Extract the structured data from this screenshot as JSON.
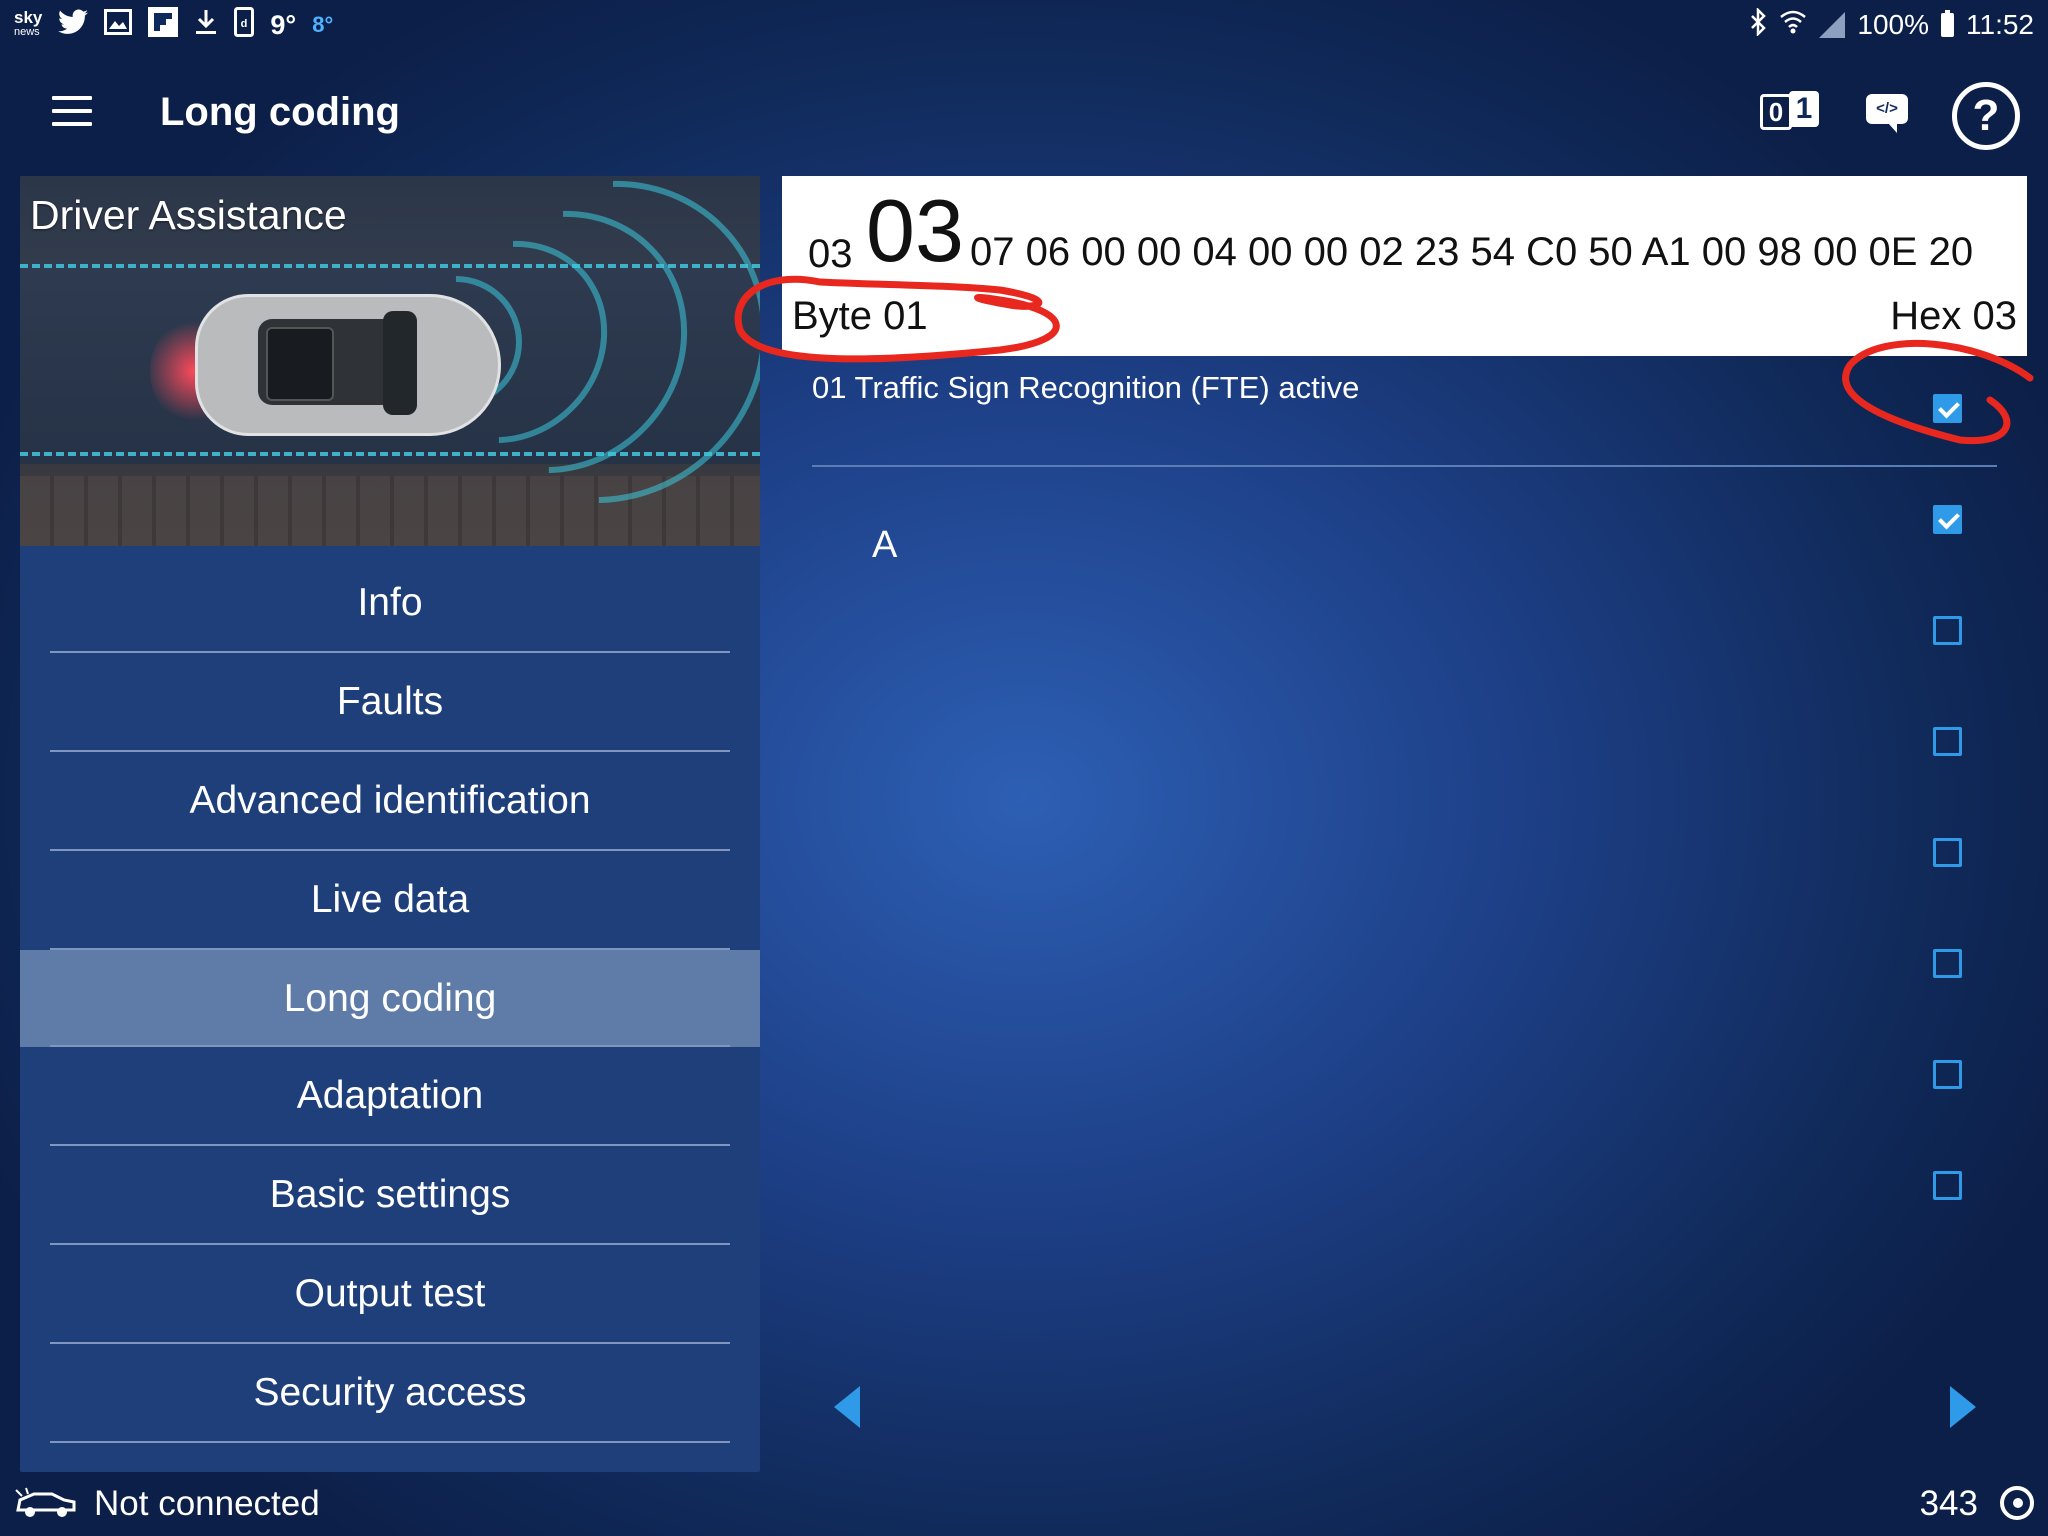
{
  "status_bar": {
    "left_icons": [
      "sky-news-icon",
      "twitter-icon",
      "gallery-icon",
      "flipboard-icon",
      "download-icon",
      "app-icon"
    ],
    "sky_label": "sky",
    "sky_sub": "news",
    "temp_primary": "9°",
    "temp_secondary": "8°",
    "battery": "100%",
    "time": "11:52"
  },
  "toolbar": {
    "title": "Long coding",
    "binary_button": {
      "digit0": "0",
      "digit1": "1"
    },
    "code_button": "</>",
    "help_button": "?"
  },
  "left_panel": {
    "hero_title": "Driver Assistance",
    "menu": [
      {
        "label": "Info",
        "active": false
      },
      {
        "label": "Faults",
        "active": false
      },
      {
        "label": "Advanced identification",
        "active": false
      },
      {
        "label": "Live data",
        "active": false
      },
      {
        "label": "Long coding",
        "active": true
      },
      {
        "label": "Adaptation",
        "active": false
      },
      {
        "label": "Basic settings",
        "active": false
      },
      {
        "label": "Output test",
        "active": false
      },
      {
        "label": "Security access",
        "active": false
      }
    ],
    "partial_item": "..."
  },
  "coding": {
    "prev_byte": "03",
    "current_byte": "03",
    "following_bytes": "07 06 00 00 04 00 00 02 23 54 C0 50 A1 00 98 00 0E 20",
    "byte_label": "Byte 01",
    "hex_label": "Hex 03",
    "bit_description": "01 Traffic Sign Recognition (FTE) active",
    "bit_letter": "A",
    "checkboxes": [
      true,
      true,
      false,
      false,
      false,
      false,
      false,
      false
    ]
  },
  "bottom_bar": {
    "connection": "Not connected",
    "counter": "343"
  },
  "colors": {
    "accent": "#2f9be8",
    "annotation": "#e8281e",
    "active_menu": "#5f7ca8"
  }
}
